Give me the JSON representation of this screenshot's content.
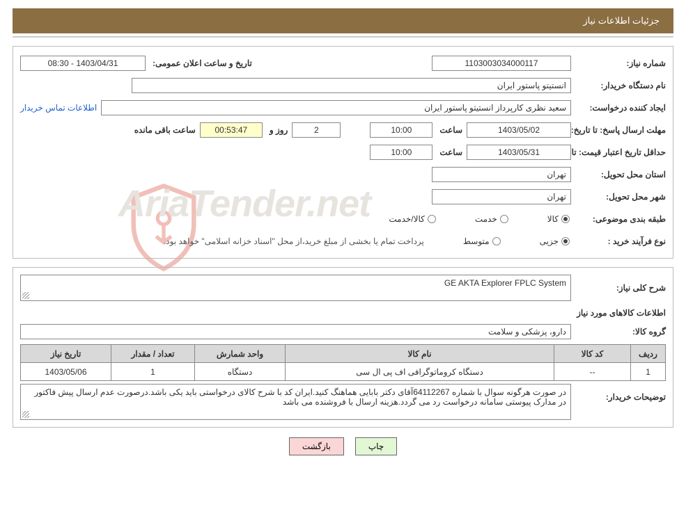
{
  "header": {
    "title": "جزئیات اطلاعات نیاز"
  },
  "watermark": "AriaTender.net",
  "panel1": {
    "need_number_label": "شماره نیاز:",
    "need_number": "1103003034000117",
    "announce_label": "تاریخ و ساعت اعلان عمومی:",
    "announce_value": "1403/04/31 - 08:30",
    "buyer_org_label": "نام دستگاه خریدار:",
    "buyer_org": "انستیتو پاستور ایران",
    "requester_label": "ایجاد کننده درخواست:",
    "requester": "سعید نظری کارپرداز انستیتو پاستور ایران",
    "contact_link": "اطلاعات تماس خریدار",
    "deadline_label": "مهلت ارسال پاسخ:",
    "to_date_label": "تا تاریخ:",
    "deadline_date": "1403/05/02",
    "time_label": "ساعت",
    "deadline_time": "10:00",
    "days_value": "2",
    "days_and_label": "روز و",
    "countdown": "00:53:47",
    "remaining_label": "ساعت باقی مانده",
    "validity_label": "حداقل تاریخ اعتبار قیمت:",
    "validity_date": "1403/05/31",
    "validity_time": "10:00",
    "province_label": "استان محل تحویل:",
    "province": "تهران",
    "city_label": "شهر محل تحویل:",
    "city": "تهران",
    "category_label": "طبقه بندی موضوعی:",
    "cat_goods": "کالا",
    "cat_service": "خدمت",
    "cat_goods_service": "کالا/خدمت",
    "purchase_type_label": "نوع فرآیند خرید :",
    "pt_partial": "جزیی",
    "pt_medium": "متوسط",
    "payment_note": "پرداخت تمام یا بخشی از مبلغ خرید،از محل \"اسناد خزانه اسلامی\" خواهد بود."
  },
  "panel2": {
    "general_desc_label": "شرح کلی نیاز:",
    "general_desc": "GE AKTA Explorer FPLC System",
    "goods_info_title": "اطلاعات کالاهای مورد نیاز",
    "goods_group_label": "گروه کالا:",
    "goods_group": "دارو، پزشکی و سلامت",
    "table": {
      "headers": [
        "ردیف",
        "کد کالا",
        "نام کالا",
        "واحد شمارش",
        "تعداد / مقدار",
        "تاریخ نیاز"
      ],
      "rows": [
        {
          "idx": "1",
          "code": "--",
          "name": "دستگاه کروماتوگرافی اف پی ال سی",
          "unit": "دستگاه",
          "qty": "1",
          "date": "1403/05/06"
        }
      ]
    },
    "buyer_notes_label": "توضیحات خریدار:",
    "buyer_notes": "در صورت هرگونه سوال با شماره 64112267آقای دکتر بابایی هماهنگ کنید.ایران کد با شرح کالای درخواستی باید یکی باشد.درصورت عدم ارسال پیش فاکتور در مدارک پیوستی سامانه درخواست رد می گردد.هزینه ارسال با فروشنده می باشد"
  },
  "buttons": {
    "print": "چاپ",
    "back": "بازگشت"
  }
}
